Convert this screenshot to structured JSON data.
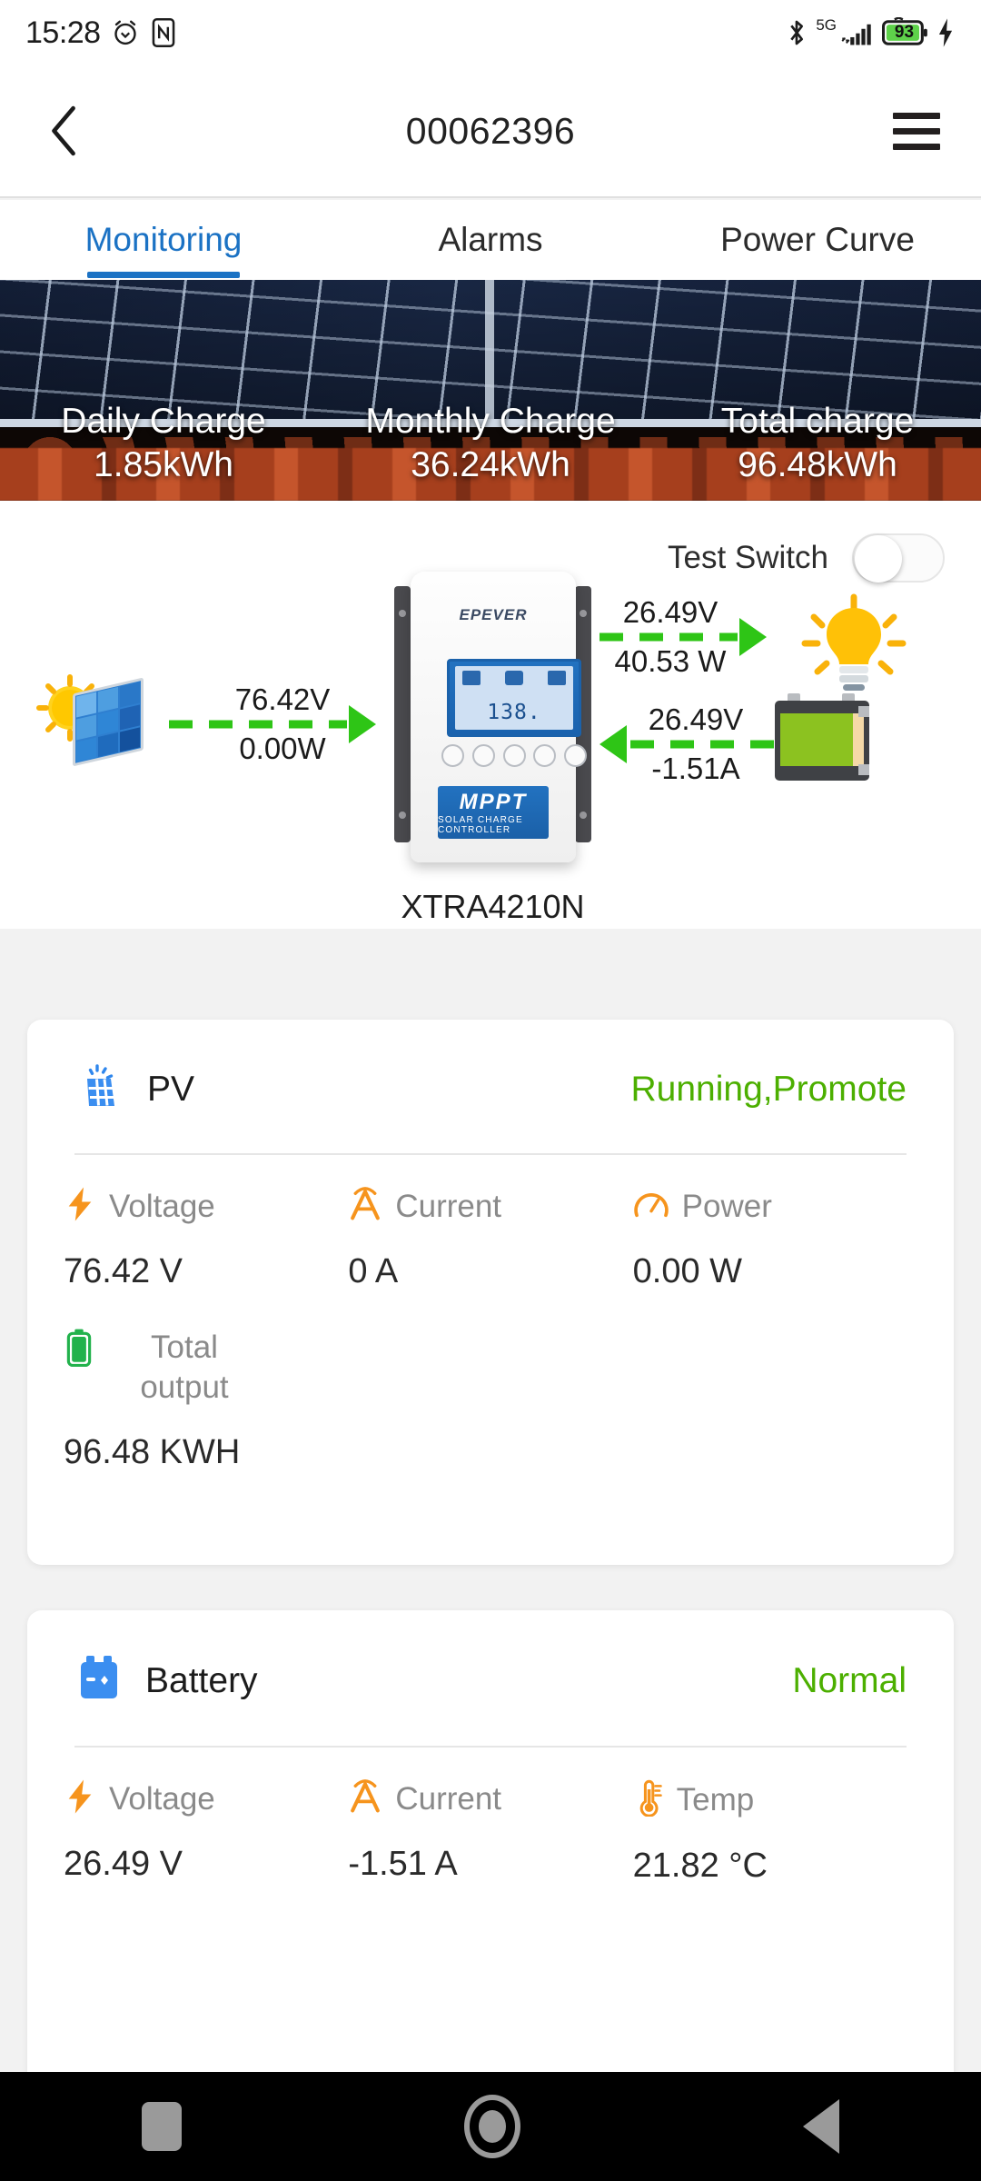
{
  "statusbar": {
    "time": "15:28",
    "alarm_icon": "alarm-clock-icon",
    "nfc_icon": "nfc-icon",
    "bluetooth_icon": "bluetooth-icon",
    "network_type": "5G",
    "signal_icon": "cellular-signal-icon",
    "battery_percent": "93",
    "charging_icon": "charging-bolt-icon"
  },
  "appbar": {
    "back_icon": "chevron-left-icon",
    "title": "00062396",
    "menu_icon": "hamburger-menu-icon"
  },
  "tabs": [
    {
      "label": "Monitoring",
      "active": true
    },
    {
      "label": "Alarms",
      "active": false
    },
    {
      "label": "Power Curve",
      "active": false
    }
  ],
  "banner": {
    "stats": [
      {
        "label": "Daily Charge",
        "value": "1.85kWh"
      },
      {
        "label": "Monthly Charge",
        "value": "36.24kWh"
      },
      {
        "label": "Total charge",
        "value": "96.48kWh"
      }
    ]
  },
  "diagram": {
    "test_switch": {
      "label": "Test Switch",
      "state": "off"
    },
    "solar_icon": "solar-panel-sun-icon",
    "pv_flow": {
      "top": "76.42V",
      "bottom": "0.00W",
      "direction": "right"
    },
    "load_flow": {
      "top": "26.49V",
      "bottom": "40.53 W",
      "direction": "right"
    },
    "battery_flow": {
      "top": "26.49V",
      "bottom": "-1.51A",
      "direction": "left"
    },
    "bulb_icon": "light-bulb-icon",
    "battery_icon": "battery-block-icon",
    "controller": {
      "brand": "EPEVER",
      "lcd_value": "138.",
      "band_title": "MPPT",
      "band_subtitle": "SOLAR CHARGE CONTROLLER",
      "model": "XTRA4210N"
    }
  },
  "colors": {
    "accent_blue": "#1b72c4",
    "status_green": "#4caf00",
    "flow_green": "#2ec516",
    "icon_orange": "#f6941d"
  },
  "cards": [
    {
      "icon": "pv-panel-icon",
      "title": "PV",
      "status": "Running,Promote",
      "status_color": "#4caf00",
      "metrics": [
        {
          "icon": "voltage-bolt-icon",
          "label": "Voltage",
          "value": "76.42 V"
        },
        {
          "icon": "current-amp-icon",
          "label": "Current",
          "value": "0 A"
        },
        {
          "icon": "power-gauge-icon",
          "label": "Power",
          "value": "0.00 W"
        }
      ],
      "metrics_row2": [
        {
          "icon": "total-output-battery-icon",
          "label": "Total output",
          "value": "96.48 KWH"
        }
      ]
    },
    {
      "icon": "battery-card-icon",
      "title": "Battery",
      "status": "Normal",
      "status_color": "#4caf00",
      "metrics": [
        {
          "icon": "voltage-bolt-icon",
          "label": "Voltage",
          "value": "26.49 V"
        },
        {
          "icon": "current-amp-icon",
          "label": "Current",
          "value": "-1.51 A"
        },
        {
          "icon": "temperature-icon",
          "label": "Temp",
          "value": "21.82 °C"
        }
      ]
    }
  ],
  "navbar": {
    "recent_icon": "square-recents-icon",
    "home_icon": "circle-home-icon",
    "back_icon": "triangle-back-icon"
  }
}
